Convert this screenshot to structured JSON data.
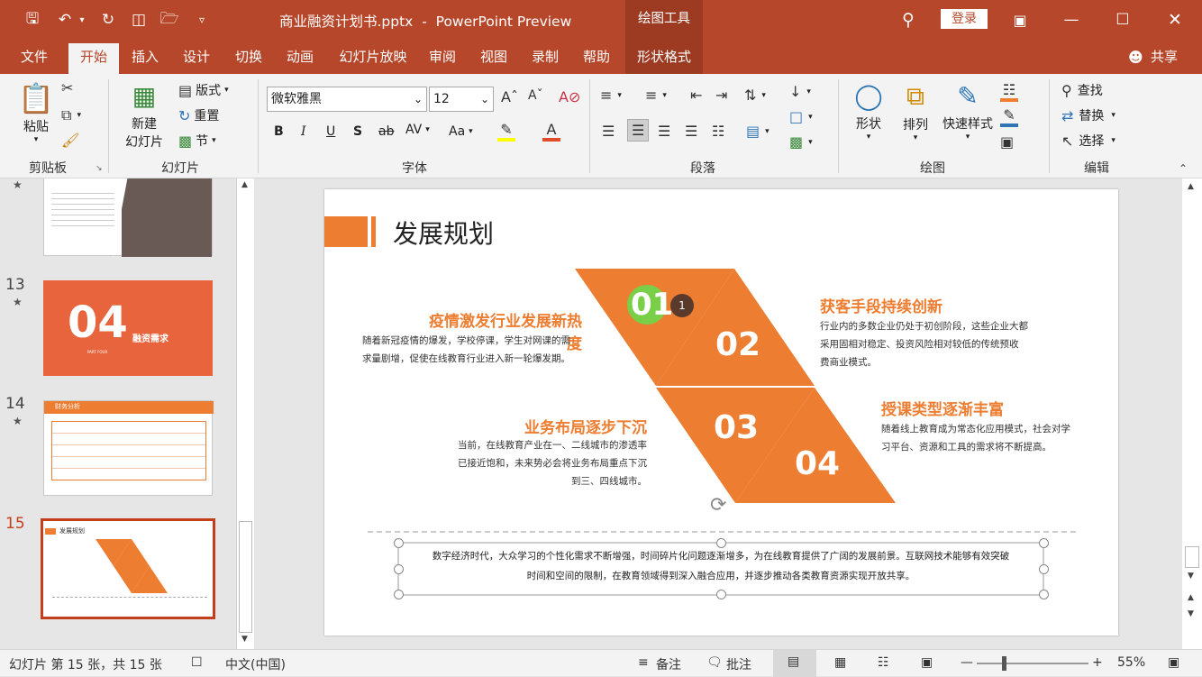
{
  "titlebar": {
    "title": "商业融资计划书.pptx  -  PowerPoint Preview",
    "context_tab": "绘图工具",
    "login": "登录"
  },
  "tabs": [
    "文件",
    "开始",
    "插入",
    "设计",
    "切换",
    "动画",
    "幻灯片放映",
    "审阅",
    "视图",
    "录制",
    "帮助",
    "形状格式"
  ],
  "share": "共享",
  "ribbon": {
    "clipboard": {
      "label": "剪贴板",
      "paste": "粘贴"
    },
    "slides": {
      "label": "幻灯片",
      "new_slide_1": "新建",
      "new_slide_2": "幻灯片",
      "layout": "版式",
      "reset": "重置",
      "section": "节"
    },
    "font": {
      "label": "字体",
      "font_name": "微软雅黑",
      "font_size": "12"
    },
    "paragraph": {
      "label": "段落"
    },
    "drawing": {
      "label": "绘图",
      "shape": "形状",
      "arrange": "排列",
      "quick_style": "快速样式"
    },
    "editing": {
      "label": "编辑",
      "find": "查找",
      "replace": "替换",
      "select": "选择"
    }
  },
  "thumbnails": [
    {
      "num": "13",
      "big": "04",
      "title": "融资需求",
      "sub": "PART FOUR"
    },
    {
      "num": "14",
      "title": "财务分析"
    },
    {
      "num": "15",
      "title": "发展规划"
    }
  ],
  "slide": {
    "title": "发展规划",
    "badge": "1",
    "nums": [
      "01",
      "02",
      "03",
      "04"
    ],
    "items": [
      {
        "title": "疫情激发行业发展新热度",
        "body": [
          "随着新冠疫情的爆发，学校停课，学生对网课的需",
          "求量剧增，促使在线教育行业进入新一轮爆发期。"
        ]
      },
      {
        "title": "获客手段持续创新",
        "body": [
          "行业内的多数企业仍处于初创阶段，这些企业大都",
          "采用固相对稳定、投资风险相对较低的传统预收",
          "费商业模式。"
        ]
      },
      {
        "title": "业务布局逐步下沉",
        "body": [
          "当前，在线教育产业在一、二线城市的渗透率",
          "已接近饱和，未来势必会将业务布局重点下沉",
          "到三、四线城市。"
        ]
      },
      {
        "title": "授课类型逐渐丰富",
        "body": [
          "随着线上教育成为常态化应用模式，社会对学",
          "习平台、资源和工具的需求将不断提高。"
        ]
      }
    ],
    "footer": [
      "数字经济时代，大众学习的个性化需求不断增强，时间碎片化问题逐渐增多，为在线教育提供了广阔的发展前景。互联网技术能够有效突破",
      "时间和空间的限制，在教育领域得到深入融合应用，并逐步推动各类教育资源实现开放共享。"
    ]
  },
  "status": {
    "slide_info": "幻灯片 第 15 张，共 15 张",
    "language": "中文(中国)",
    "notes": "备注",
    "comments": "批注",
    "zoom": "55%"
  },
  "colors": {
    "accent": "#b7472a",
    "orange": "#ed7d31",
    "slide_orange": "#e8643c"
  }
}
